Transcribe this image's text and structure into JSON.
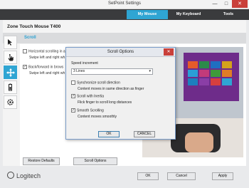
{
  "window": {
    "title": "SetPoint Settings",
    "minimize": "—",
    "maximize": "□",
    "close": "✕"
  },
  "tabs": [
    {
      "label": "My Mouse"
    },
    {
      "label": "My Keyboard"
    },
    {
      "label": "Tools"
    }
  ],
  "device": {
    "name": "Zone Touch Mouse T400"
  },
  "section": {
    "label": "Scroll"
  },
  "options": {
    "horizontal_label": "Horizontal scrolling in a",
    "horizontal_desc": "Swipe left and right wh",
    "backforward_label": "Back/forward in brows",
    "backforward_desc": "Swipe left and right wh"
  },
  "buttons": {
    "restore": "Restore Defaults",
    "scroll_options": "Scroll Options",
    "ok": "OK",
    "cancel": "Cancel",
    "apply": "Apply"
  },
  "logo": {
    "text": "Logitech"
  },
  "dialog": {
    "title": "Scroll Options",
    "close": "✕",
    "speed_label": "Speed increment",
    "speed_value": "3 Lines",
    "sync_label": "Synchronize scroll direction",
    "sync_desc": "Content moves in same direction as finger",
    "inertia_label": "Scroll with Inertia",
    "inertia_desc": "Flick finger to scroll long distances",
    "smooth_label": "Smooth Scrolling",
    "smooth_desc": "Content moves smoothly",
    "ok": "OK",
    "cancel": "CANCEL"
  },
  "checks": {
    "checked": "✓",
    "unchecked": ""
  },
  "colors": {
    "accent": "#2fa5d3",
    "topbar": "#3a3b3d"
  }
}
